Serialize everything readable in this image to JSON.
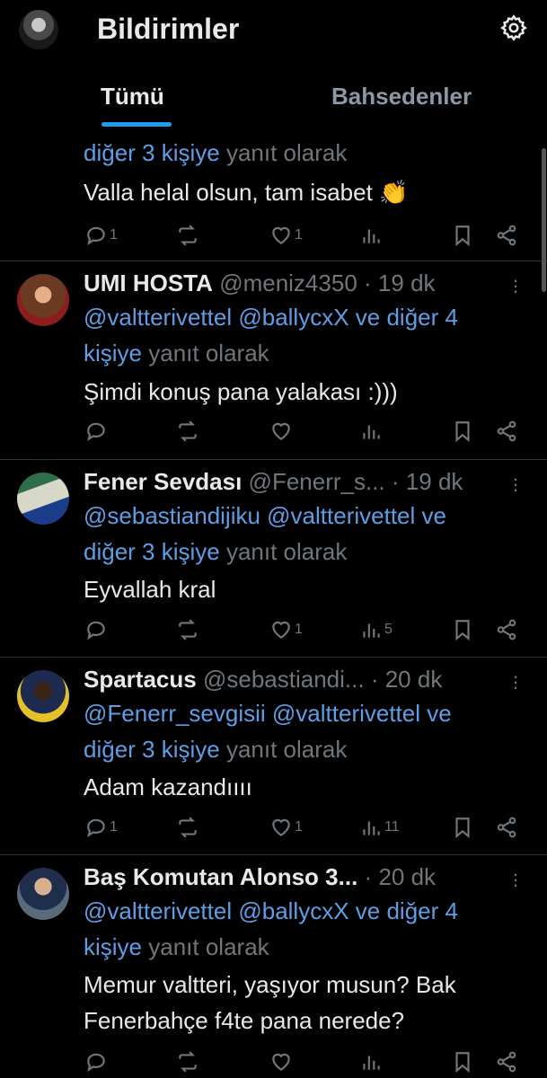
{
  "header": {
    "title": "Bildirimler",
    "tabs": [
      {
        "label": "Tümü",
        "active": true
      },
      {
        "label": "Bahsedenler",
        "active": false
      }
    ]
  },
  "icons": {
    "settings": "gear-icon",
    "reply": "reply-icon",
    "retweet": "retweet-icon",
    "like": "heart-icon",
    "views": "views-icon",
    "bookmark": "bookmark-icon",
    "share": "share-icon",
    "more": "more-icon"
  },
  "colors": {
    "accent": "#1d9bf0",
    "mention": "#5d9fe7",
    "muted": "#71767b",
    "text": "#e7e9ea",
    "background": "#000000"
  },
  "tweets": [
    {
      "name": "",
      "handle": "",
      "time": "",
      "reply_prefix": "",
      "reply_mentions": "diğer 3 kişiye",
      "reply_suffix": "yanıt olarak",
      "reply_line2_mentions": "",
      "reply_line2_suffix": "",
      "text": "Valla helal olsun, tam isabet 👏",
      "text2": "",
      "replies": "1",
      "retweets": "",
      "likes": "1",
      "views": ""
    },
    {
      "name": "UMI HOSTA",
      "handle": "@meniz4350",
      "time": "19 dk",
      "reply_mentions": "@valtterivettel @ballycxX ve diğer 4",
      "reply_line2_mentions": "kişiye",
      "reply_line2_suffix": "yanıt olarak",
      "text": "Şimdi konuş pana yalakası :)))",
      "replies": "",
      "retweets": "",
      "likes": "",
      "views": ""
    },
    {
      "name": "Fener Sevdası",
      "handle": "@Fenerr_s...",
      "time": "19 dk",
      "reply_mentions": "@sebastiandijiku @valtterivettel ve",
      "reply_line2_mentions": "diğer 3 kişiye",
      "reply_line2_suffix": "yanıt olarak",
      "text": "Eyvallah kral",
      "replies": "",
      "retweets": "",
      "likes": "1",
      "views": "5"
    },
    {
      "name": "Spartacus",
      "handle": "@sebastiandi...",
      "time": "20 dk",
      "reply_mentions": "@Fenerr_sevgisii @valtterivettel ve",
      "reply_line2_mentions": "diğer 3 kişiye",
      "reply_line2_suffix": "yanıt olarak",
      "text": "Adam kazandıııı",
      "replies": "1",
      "retweets": "",
      "likes": "1",
      "views": "11"
    },
    {
      "name": "Baş Komutan Alonso 3...",
      "handle": "",
      "time": "20 dk",
      "reply_mentions": "@valtterivettel @ballycxX ve diğer 4",
      "reply_line2_mentions": "kişiye",
      "reply_line2_suffix": "yanıt olarak",
      "text": "Memur valtteri, yaşıyor musun? Bak",
      "text2": "Fenerbahçe f4te pana nerede?",
      "replies": "",
      "retweets": "",
      "likes": "",
      "views": ""
    }
  ]
}
